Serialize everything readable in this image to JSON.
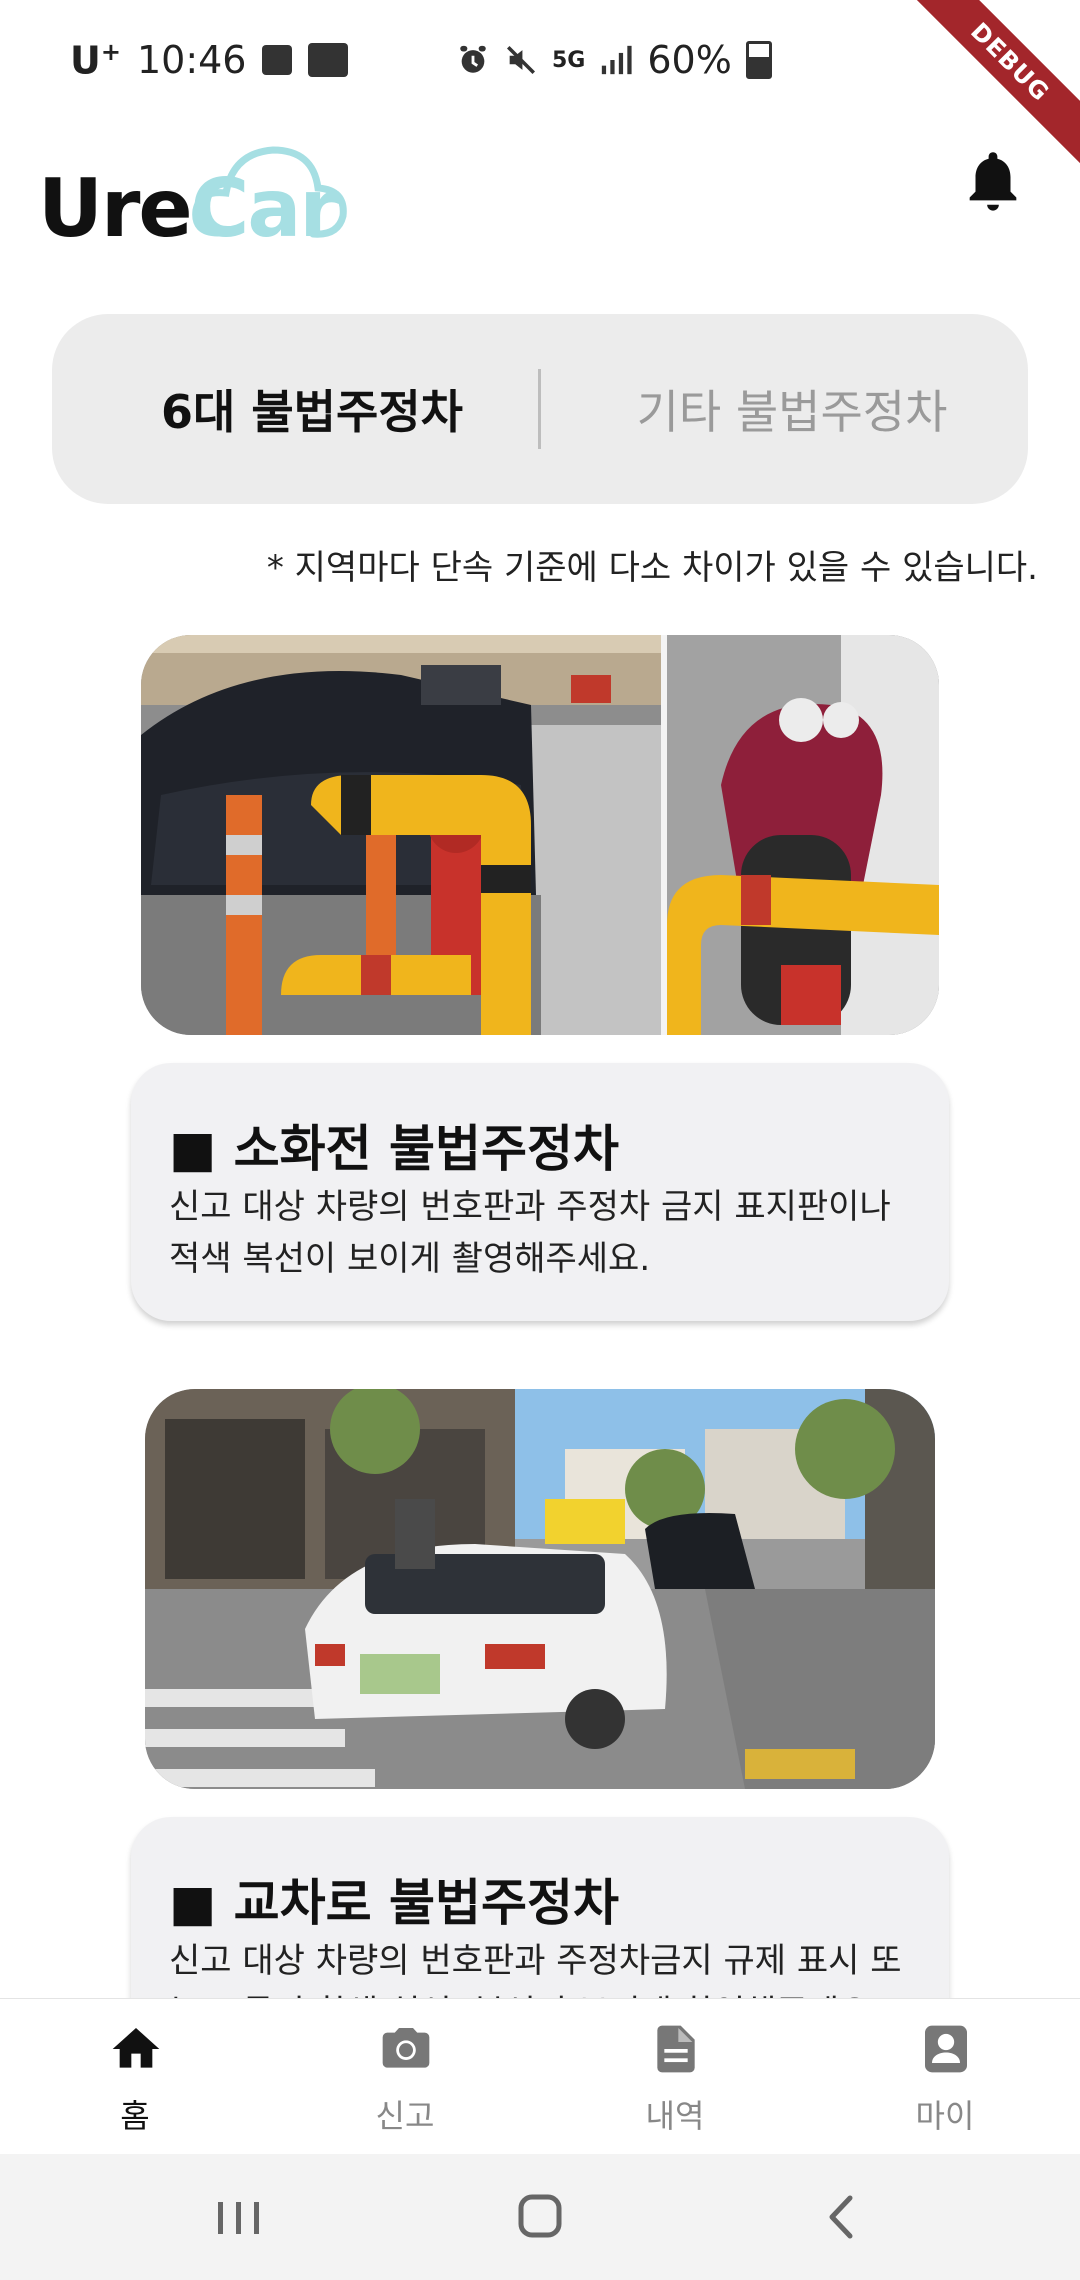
{
  "status_bar": {
    "carrier": "U",
    "carrier_sup": "+",
    "time": "10:46",
    "network": "5G",
    "battery": "60%"
  },
  "debug_banner": "DEBUG",
  "header": {
    "logo_part1": "Ure",
    "logo_part2": "Car",
    "notification_icon": "bell-icon"
  },
  "tabs": [
    {
      "label": "6대 불법주정차",
      "active": true
    },
    {
      "label": "기타 불법주정차",
      "active": false
    }
  ],
  "notice": "* 지역마다 단속 기준에 다소 차이가 있을 수 있습니다.",
  "cards": [
    {
      "title": "■ 소화전 불법주정차",
      "description": "신고 대상 차량의 번호판과 주정차 금지 표지판이나 적색 복선이 보이게 촬영해주세요."
    },
    {
      "title": "■ 교차로 불법주정차",
      "description": "신고 대상 차량의 번호판과 주정차금지 규제 표시 또는 모퉁이 황색 실선, 복선이 보이게 촬영해주세요."
    }
  ],
  "bottom_nav": [
    {
      "label": "홈",
      "icon": "home-icon",
      "active": true
    },
    {
      "label": "신고",
      "icon": "camera-icon",
      "active": false
    },
    {
      "label": "내역",
      "icon": "document-icon",
      "active": false
    },
    {
      "label": "마이",
      "icon": "person-icon",
      "active": false
    }
  ],
  "colors": {
    "accent": "#a6dfe3",
    "tab_bg": "#ececec",
    "card_bg": "#f1f1f3",
    "debug": "#a3262b"
  }
}
